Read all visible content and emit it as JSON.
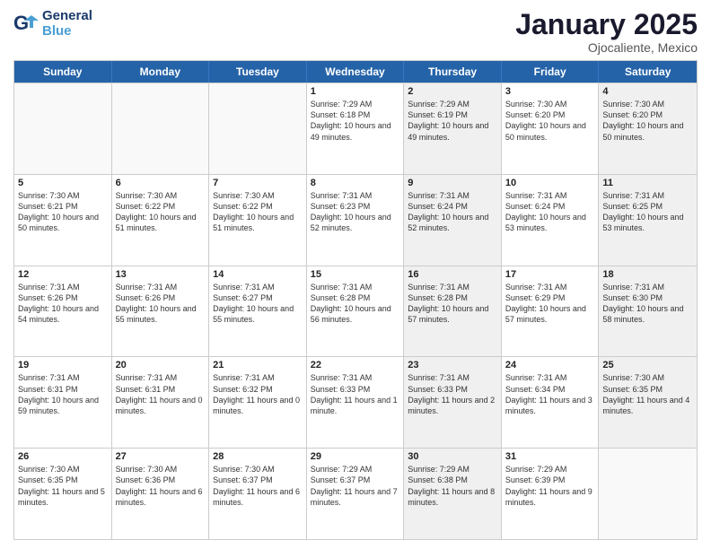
{
  "logo": {
    "line1": "General",
    "line2": "Blue"
  },
  "title": "January 2025",
  "location": "Ojocaliente, Mexico",
  "header_days": [
    "Sunday",
    "Monday",
    "Tuesday",
    "Wednesday",
    "Thursday",
    "Friday",
    "Saturday"
  ],
  "rows": [
    [
      {
        "day": "",
        "sunrise": "",
        "sunset": "",
        "daylight": "",
        "shaded": false,
        "empty": true
      },
      {
        "day": "",
        "sunrise": "",
        "sunset": "",
        "daylight": "",
        "shaded": false,
        "empty": true
      },
      {
        "day": "",
        "sunrise": "",
        "sunset": "",
        "daylight": "",
        "shaded": false,
        "empty": true
      },
      {
        "day": "1",
        "sunrise": "Sunrise: 7:29 AM",
        "sunset": "Sunset: 6:18 PM",
        "daylight": "Daylight: 10 hours and 49 minutes.",
        "shaded": false,
        "empty": false
      },
      {
        "day": "2",
        "sunrise": "Sunrise: 7:29 AM",
        "sunset": "Sunset: 6:19 PM",
        "daylight": "Daylight: 10 hours and 49 minutes.",
        "shaded": true,
        "empty": false
      },
      {
        "day": "3",
        "sunrise": "Sunrise: 7:30 AM",
        "sunset": "Sunset: 6:20 PM",
        "daylight": "Daylight: 10 hours and 50 minutes.",
        "shaded": false,
        "empty": false
      },
      {
        "day": "4",
        "sunrise": "Sunrise: 7:30 AM",
        "sunset": "Sunset: 6:20 PM",
        "daylight": "Daylight: 10 hours and 50 minutes.",
        "shaded": true,
        "empty": false
      }
    ],
    [
      {
        "day": "5",
        "sunrise": "Sunrise: 7:30 AM",
        "sunset": "Sunset: 6:21 PM",
        "daylight": "Daylight: 10 hours and 50 minutes.",
        "shaded": false,
        "empty": false
      },
      {
        "day": "6",
        "sunrise": "Sunrise: 7:30 AM",
        "sunset": "Sunset: 6:22 PM",
        "daylight": "Daylight: 10 hours and 51 minutes.",
        "shaded": false,
        "empty": false
      },
      {
        "day": "7",
        "sunrise": "Sunrise: 7:30 AM",
        "sunset": "Sunset: 6:22 PM",
        "daylight": "Daylight: 10 hours and 51 minutes.",
        "shaded": false,
        "empty": false
      },
      {
        "day": "8",
        "sunrise": "Sunrise: 7:31 AM",
        "sunset": "Sunset: 6:23 PM",
        "daylight": "Daylight: 10 hours and 52 minutes.",
        "shaded": false,
        "empty": false
      },
      {
        "day": "9",
        "sunrise": "Sunrise: 7:31 AM",
        "sunset": "Sunset: 6:24 PM",
        "daylight": "Daylight: 10 hours and 52 minutes.",
        "shaded": true,
        "empty": false
      },
      {
        "day": "10",
        "sunrise": "Sunrise: 7:31 AM",
        "sunset": "Sunset: 6:24 PM",
        "daylight": "Daylight: 10 hours and 53 minutes.",
        "shaded": false,
        "empty": false
      },
      {
        "day": "11",
        "sunrise": "Sunrise: 7:31 AM",
        "sunset": "Sunset: 6:25 PM",
        "daylight": "Daylight: 10 hours and 53 minutes.",
        "shaded": true,
        "empty": false
      }
    ],
    [
      {
        "day": "12",
        "sunrise": "Sunrise: 7:31 AM",
        "sunset": "Sunset: 6:26 PM",
        "daylight": "Daylight: 10 hours and 54 minutes.",
        "shaded": false,
        "empty": false
      },
      {
        "day": "13",
        "sunrise": "Sunrise: 7:31 AM",
        "sunset": "Sunset: 6:26 PM",
        "daylight": "Daylight: 10 hours and 55 minutes.",
        "shaded": false,
        "empty": false
      },
      {
        "day": "14",
        "sunrise": "Sunrise: 7:31 AM",
        "sunset": "Sunset: 6:27 PM",
        "daylight": "Daylight: 10 hours and 55 minutes.",
        "shaded": false,
        "empty": false
      },
      {
        "day": "15",
        "sunrise": "Sunrise: 7:31 AM",
        "sunset": "Sunset: 6:28 PM",
        "daylight": "Daylight: 10 hours and 56 minutes.",
        "shaded": false,
        "empty": false
      },
      {
        "day": "16",
        "sunrise": "Sunrise: 7:31 AM",
        "sunset": "Sunset: 6:28 PM",
        "daylight": "Daylight: 10 hours and 57 minutes.",
        "shaded": true,
        "empty": false
      },
      {
        "day": "17",
        "sunrise": "Sunrise: 7:31 AM",
        "sunset": "Sunset: 6:29 PM",
        "daylight": "Daylight: 10 hours and 57 minutes.",
        "shaded": false,
        "empty": false
      },
      {
        "day": "18",
        "sunrise": "Sunrise: 7:31 AM",
        "sunset": "Sunset: 6:30 PM",
        "daylight": "Daylight: 10 hours and 58 minutes.",
        "shaded": true,
        "empty": false
      }
    ],
    [
      {
        "day": "19",
        "sunrise": "Sunrise: 7:31 AM",
        "sunset": "Sunset: 6:31 PM",
        "daylight": "Daylight: 10 hours and 59 minutes.",
        "shaded": false,
        "empty": false
      },
      {
        "day": "20",
        "sunrise": "Sunrise: 7:31 AM",
        "sunset": "Sunset: 6:31 PM",
        "daylight": "Daylight: 11 hours and 0 minutes.",
        "shaded": false,
        "empty": false
      },
      {
        "day": "21",
        "sunrise": "Sunrise: 7:31 AM",
        "sunset": "Sunset: 6:32 PM",
        "daylight": "Daylight: 11 hours and 0 minutes.",
        "shaded": false,
        "empty": false
      },
      {
        "day": "22",
        "sunrise": "Sunrise: 7:31 AM",
        "sunset": "Sunset: 6:33 PM",
        "daylight": "Daylight: 11 hours and 1 minute.",
        "shaded": false,
        "empty": false
      },
      {
        "day": "23",
        "sunrise": "Sunrise: 7:31 AM",
        "sunset": "Sunset: 6:33 PM",
        "daylight": "Daylight: 11 hours and 2 minutes.",
        "shaded": true,
        "empty": false
      },
      {
        "day": "24",
        "sunrise": "Sunrise: 7:31 AM",
        "sunset": "Sunset: 6:34 PM",
        "daylight": "Daylight: 11 hours and 3 minutes.",
        "shaded": false,
        "empty": false
      },
      {
        "day": "25",
        "sunrise": "Sunrise: 7:30 AM",
        "sunset": "Sunset: 6:35 PM",
        "daylight": "Daylight: 11 hours and 4 minutes.",
        "shaded": true,
        "empty": false
      }
    ],
    [
      {
        "day": "26",
        "sunrise": "Sunrise: 7:30 AM",
        "sunset": "Sunset: 6:35 PM",
        "daylight": "Daylight: 11 hours and 5 minutes.",
        "shaded": false,
        "empty": false
      },
      {
        "day": "27",
        "sunrise": "Sunrise: 7:30 AM",
        "sunset": "Sunset: 6:36 PM",
        "daylight": "Daylight: 11 hours and 6 minutes.",
        "shaded": false,
        "empty": false
      },
      {
        "day": "28",
        "sunrise": "Sunrise: 7:30 AM",
        "sunset": "Sunset: 6:37 PM",
        "daylight": "Daylight: 11 hours and 6 minutes.",
        "shaded": false,
        "empty": false
      },
      {
        "day": "29",
        "sunrise": "Sunrise: 7:29 AM",
        "sunset": "Sunset: 6:37 PM",
        "daylight": "Daylight: 11 hours and 7 minutes.",
        "shaded": false,
        "empty": false
      },
      {
        "day": "30",
        "sunrise": "Sunrise: 7:29 AM",
        "sunset": "Sunset: 6:38 PM",
        "daylight": "Daylight: 11 hours and 8 minutes.",
        "shaded": true,
        "empty": false
      },
      {
        "day": "31",
        "sunrise": "Sunrise: 7:29 AM",
        "sunset": "Sunset: 6:39 PM",
        "daylight": "Daylight: 11 hours and 9 minutes.",
        "shaded": false,
        "empty": false
      },
      {
        "day": "",
        "sunrise": "",
        "sunset": "",
        "daylight": "",
        "shaded": true,
        "empty": true
      }
    ]
  ]
}
